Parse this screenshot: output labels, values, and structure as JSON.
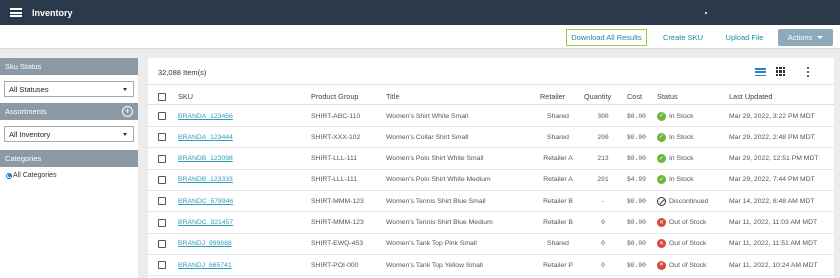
{
  "app": {
    "title": "Inventory"
  },
  "actions": {
    "download_all": "Download All Results",
    "create_sku": "Create SKU",
    "upload_file": "Upload File",
    "actions": "Actions"
  },
  "sidebar": {
    "sku_status": {
      "heading": "Sku Status",
      "selected": "All Statuses"
    },
    "assortments": {
      "heading": "Assortments",
      "selected": "All Inventory"
    },
    "categories": {
      "heading": "Categories",
      "selected": "All Categories"
    }
  },
  "results": {
    "count": "32,088 Item(s)"
  },
  "table": {
    "headers": [
      "SKU",
      "Product Group",
      "Title",
      "Retailer",
      "Quantity",
      "Cost",
      "Status",
      "Last Updated"
    ],
    "rows": [
      [
        "BRANDA_123456",
        "SHIRT-ABC-110",
        "Women's Shirt White Small",
        "Shared",
        "300",
        "$0.00",
        "In Stock",
        "Mar 29, 2022, 3:22 PM MDT"
      ],
      [
        "BRANDA_123444",
        "SHIRT-XXX-102",
        "Women's Collar Shirt Small",
        "Shared",
        "200",
        "$0.00",
        "In Stock",
        "Mar 29, 2022, 2:48 PM MDT"
      ],
      [
        "BRANDB_123098",
        "SHIRT-LLL-111",
        "Women's Polo Shirt White Small",
        "Retailer A",
        "213",
        "$0.00",
        "In Stock",
        "Mar 29, 2022, 12:51 PM MDT"
      ],
      [
        "BRANDB_123333",
        "SHIRT-LLL-111",
        "Women's Polo Shirt White Medium",
        "Retailer A",
        "201",
        "$4.99",
        "In Stock",
        "Mar 29, 2022, 7:44 PM MDT"
      ],
      [
        "BRANDC_578946",
        "SHIRT-MMM-123",
        "Women's Tennis Shirt Blue Small",
        "Retailer B",
        "-",
        "$0.00",
        "Discontinued",
        "Mar 14, 2022, 8:48 AM MDT"
      ],
      [
        "BRANDC_321457",
        "SHIRT-MMM-123",
        "Women's Tennis Shirt Blue Medium",
        "Retailer B",
        "0",
        "$0.00",
        "Out of Stock",
        "Mar 11, 2022, 11:03 AM MDT"
      ],
      [
        "BRANDJ_999888",
        "SHIRT-EWQ-453",
        "Women's Tank Top Pink Small",
        "Shared",
        "0",
        "$0.00",
        "Out of Stock",
        "Mar 11, 2022, 11:51 AM MDT"
      ],
      [
        "BRANDJ_665741",
        "SHIRT-POI-000",
        "Women's Tank Top Yellow Small",
        "Retailer P",
        "0",
        "$0.00",
        "Out of Stock",
        "Mar 11, 2022, 10:24 AM MDT"
      ]
    ]
  },
  "colors": {
    "topbar": "#2b3a4b",
    "link": "#2c9fb3",
    "in_stock": "#6db73a",
    "out_of_stock": "#d9463c",
    "actions_button": "#8fa9bc"
  },
  "icons": {
    "menu": "hamburger-icon",
    "plus": "plus-circle-icon",
    "list_view": "list-view-icon",
    "grid_view": "grid-view-icon",
    "more": "kebab-icon"
  }
}
